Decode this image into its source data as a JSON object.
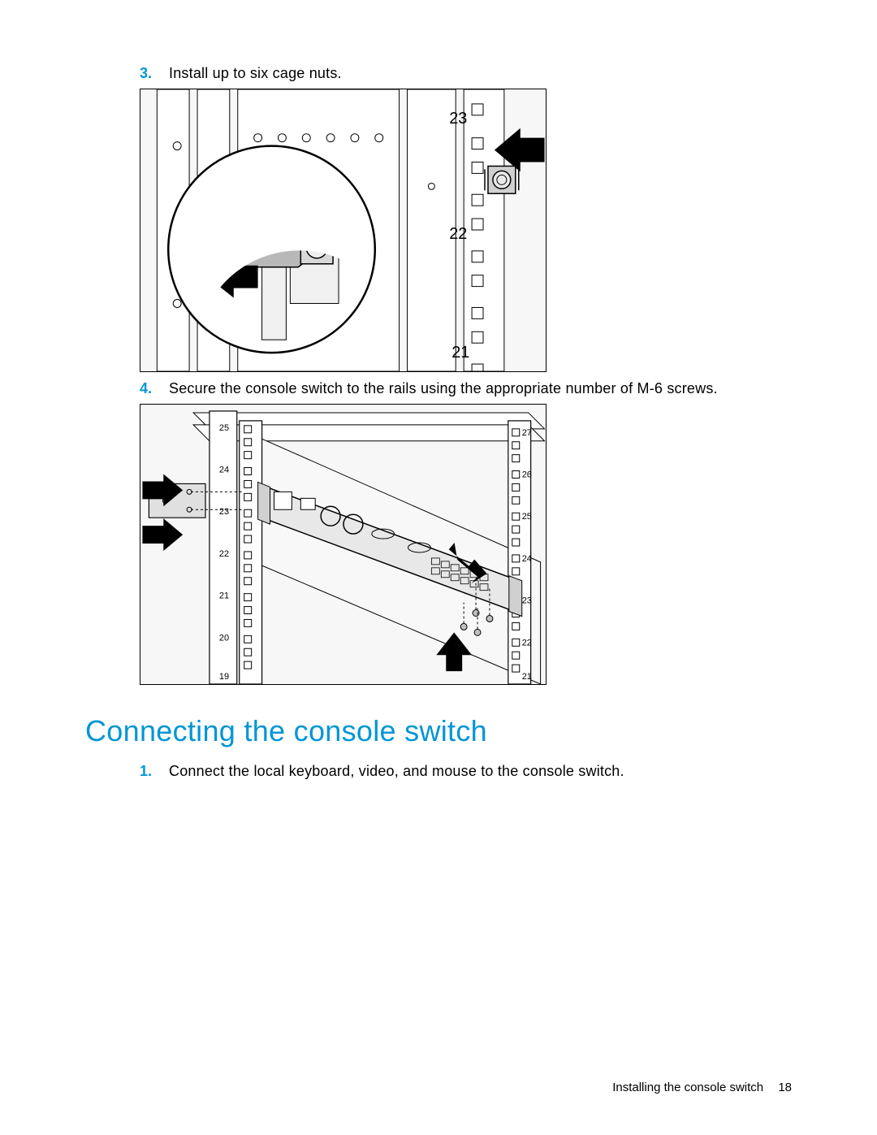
{
  "steps_top": [
    {
      "num": "3.",
      "text": "Install up to six cage nuts."
    },
    {
      "num": "4.",
      "text": "Secure the console switch to the rails using the appropriate number of M-6 screws."
    }
  ],
  "heading": "Connecting the console switch",
  "steps_bottom": [
    {
      "num": "1.",
      "text": "Connect the local keyboard, video, and mouse to the console switch."
    }
  ],
  "figure1": {
    "rack_labels": [
      "23",
      "22",
      "21"
    ]
  },
  "figure2": {
    "left_rail": [
      "25",
      "24",
      "23",
      "22",
      "21",
      "20",
      "19"
    ],
    "right_rail": [
      "27",
      "26",
      "25",
      "24",
      "23",
      "22",
      "21"
    ]
  },
  "footer": {
    "section": "Installing the console switch",
    "page": "18"
  }
}
